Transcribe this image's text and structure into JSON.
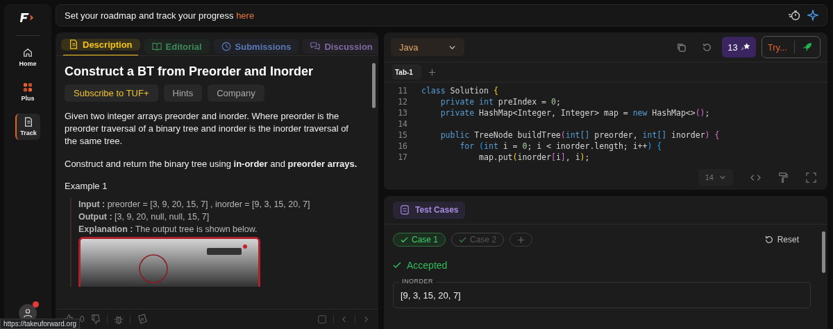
{
  "banner": {
    "text": "Set your roadmap and track your progress ",
    "link": "here"
  },
  "sidebar": {
    "items": [
      {
        "label": "Home",
        "kind": "home",
        "selected": false
      },
      {
        "label": "Plus",
        "kind": "plus",
        "selected": false
      },
      {
        "label": "Track",
        "kind": "track",
        "selected": true
      }
    ]
  },
  "problem": {
    "tabs": [
      {
        "label": "Description",
        "kind": "doc",
        "color": "#f5c518",
        "selected": true
      },
      {
        "label": "Editorial",
        "kind": "book",
        "color": "#3f8a5a",
        "selected": false
      },
      {
        "label": "Submissions",
        "kind": "clock",
        "color": "#5a78b5",
        "selected": false
      },
      {
        "label": "Discussion",
        "kind": "chat",
        "color": "#7e6aa3",
        "selected": false
      }
    ],
    "title": "Construct a BT from Preorder and Inorder",
    "chips": [
      {
        "label": "Subscribe to TUF+",
        "kind": "promo"
      },
      {
        "label": "Hints",
        "kind": "plain"
      },
      {
        "label": "Company",
        "kind": "plain"
      }
    ],
    "paragraphs": [
      "Given two integer arrays preorder and inorder. Where preorder is the preorder traversal of a binary tree and inorder is the inorder traversal of the same tree.",
      "Construct and return the binary tree using **in-order** and **preorder arrays.**"
    ],
    "example_title": "Example 1",
    "example": [
      "**Input :** preorder = [3, 9, 20, 15, 7] , inorder = [9, 3, 15, 20, 7]",
      "**Output :** [3, 9, 20, null, null, 15, 7]",
      "**Explanation :** The output tree is shown below."
    ],
    "image": {
      "kind": "picture"
    },
    "likes": "0"
  },
  "editor": {
    "language": "Java",
    "credits": "13",
    "try_label": "Try...",
    "tabs": [
      {
        "label": "Tab-1",
        "selected": true
      }
    ],
    "lines": [
      {
        "n": "11",
        "tokens": [
          {
            "text": "class",
            "kind": "keyword"
          },
          {
            "text": " Solution ",
            "kind": "plain"
          },
          {
            "text": "{",
            "kind": "brace1"
          }
        ]
      },
      {
        "n": "12",
        "tokens": [
          {
            "text": "    private",
            "kind": "keyword"
          },
          {
            "text": " int",
            "kind": "keyword"
          },
          {
            "text": " preIndex = ",
            "kind": "plain"
          },
          {
            "text": "0",
            "kind": "number"
          },
          {
            "text": ";",
            "kind": "plain"
          }
        ]
      },
      {
        "n": "13",
        "tokens": [
          {
            "text": "    private",
            "kind": "keyword"
          },
          {
            "text": " HashMap<Integer, Integer> map = ",
            "kind": "plain"
          },
          {
            "text": "new",
            "kind": "keyword"
          },
          {
            "text": " HashMap<>",
            "kind": "plain"
          },
          {
            "text": "()",
            "kind": "brace2"
          },
          {
            "text": ";",
            "kind": "plain"
          }
        ]
      },
      {
        "n": "14"
      },
      {
        "n": "15",
        "tokens": [
          {
            "text": "    public",
            "kind": "keyword"
          },
          {
            "text": " TreeNode buildTree",
            "kind": "plain"
          },
          {
            "text": "(",
            "kind": "brace2"
          },
          {
            "text": "int[]",
            "kind": "keyword"
          },
          {
            "text": " preorder, ",
            "kind": "plain"
          },
          {
            "text": "int[]",
            "kind": "keyword"
          },
          {
            "text": " inorder",
            "kind": "plain"
          },
          {
            "text": ")",
            "kind": "brace2"
          },
          {
            "text": " {",
            "kind": "brace2"
          }
        ]
      },
      {
        "n": "16",
        "tokens": [
          {
            "text": "        for",
            "kind": "keyword"
          },
          {
            "text": " (",
            "kind": "brace3"
          },
          {
            "text": "int",
            "kind": "keyword"
          },
          {
            "text": " i = ",
            "kind": "plain"
          },
          {
            "text": "0",
            "kind": "number"
          },
          {
            "text": "; i < inorder.length; i++",
            "kind": "plain"
          },
          {
            "text": ")",
            "kind": "brace3"
          },
          {
            "text": " {",
            "kind": "brace3"
          }
        ]
      },
      {
        "n": "17",
        "tokens": [
          {
            "text": "            map.put",
            "kind": "plain"
          },
          {
            "text": "(",
            "kind": "brace1"
          },
          {
            "text": "inorder",
            "kind": "plain"
          },
          {
            "text": "[",
            "kind": "brace2"
          },
          {
            "text": "i",
            "kind": "plain"
          },
          {
            "text": "]",
            "kind": "brace2"
          },
          {
            "text": ", i",
            "kind": "plain"
          },
          {
            "text": ")",
            "kind": "brace1"
          },
          {
            "text": ";",
            "kind": "plain"
          }
        ]
      }
    ],
    "font_size": "14"
  },
  "tests": {
    "title": "Test Cases",
    "cases": [
      {
        "label": "Case 1",
        "selected": true
      },
      {
        "label": "Case 2",
        "selected": false
      }
    ],
    "reset": "Reset",
    "status": "Accepted",
    "field_label": "INORDER",
    "field_value": "[9, 3, 15, 20, 7]"
  },
  "status_url": "https://takeuforward.org"
}
